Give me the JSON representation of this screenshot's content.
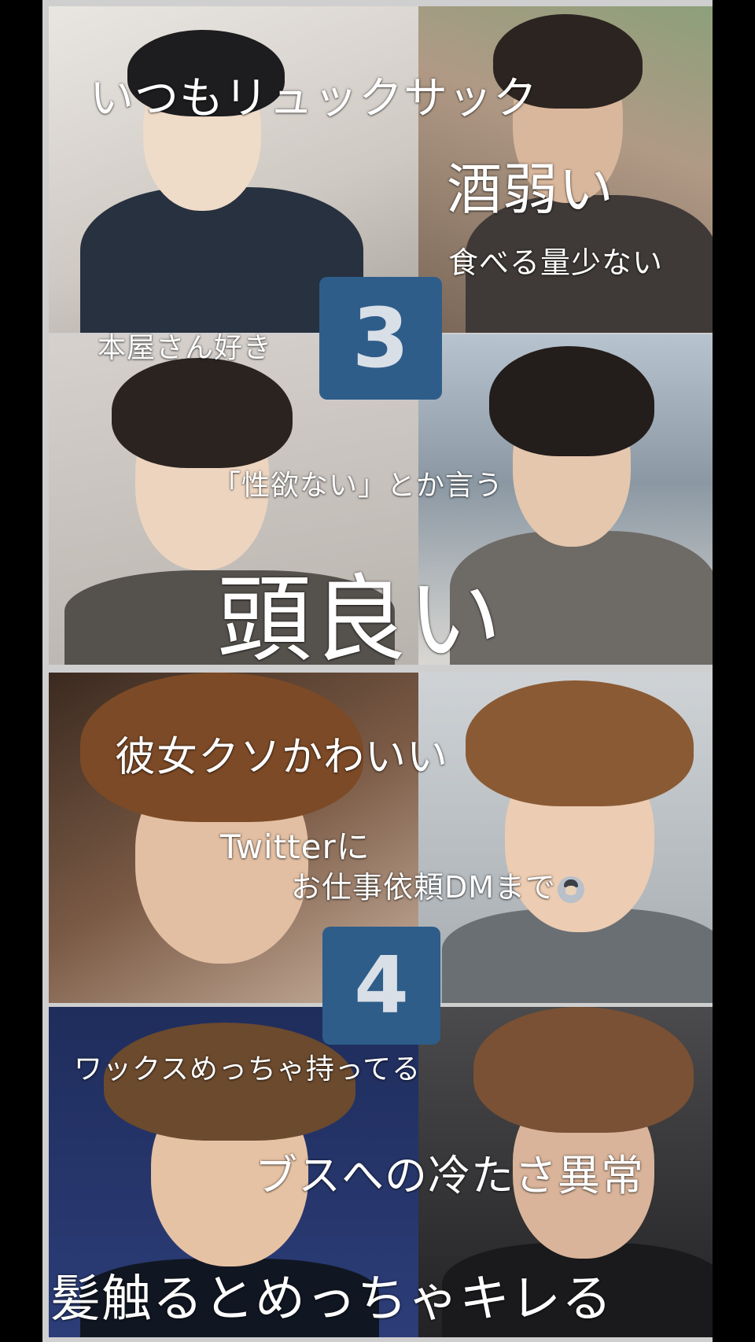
{
  "section_badges": [
    "3",
    "4"
  ],
  "captions": {
    "backpack": "いつもリュックサック",
    "weak_alcohol": "酒弱い",
    "eats_little": "食べる量少ない",
    "likes_bookstores": "本屋さん好き",
    "says_no_libido": "「性欲ない」とか言う",
    "smart": "頭良い",
    "cute_girlfriend": "彼女クソかわいい",
    "twitter_line1": "Twitterに",
    "twitter_line2": "お仕事依頼DMまで",
    "lots_of_wax": "ワックスめっちゃ持ってる",
    "cold_to_ugly": "ブスへの冷たさ異常",
    "hair_touch_angry": "髪触るとめっちゃキレる"
  },
  "icons": {
    "twitter_emoji": "person-bowing-emoji"
  },
  "colors": {
    "badge_bg": "#2e5d8a",
    "badge_text": "#d9dfe6",
    "caption_text": "#ffffff",
    "outer_border": "#000000"
  }
}
